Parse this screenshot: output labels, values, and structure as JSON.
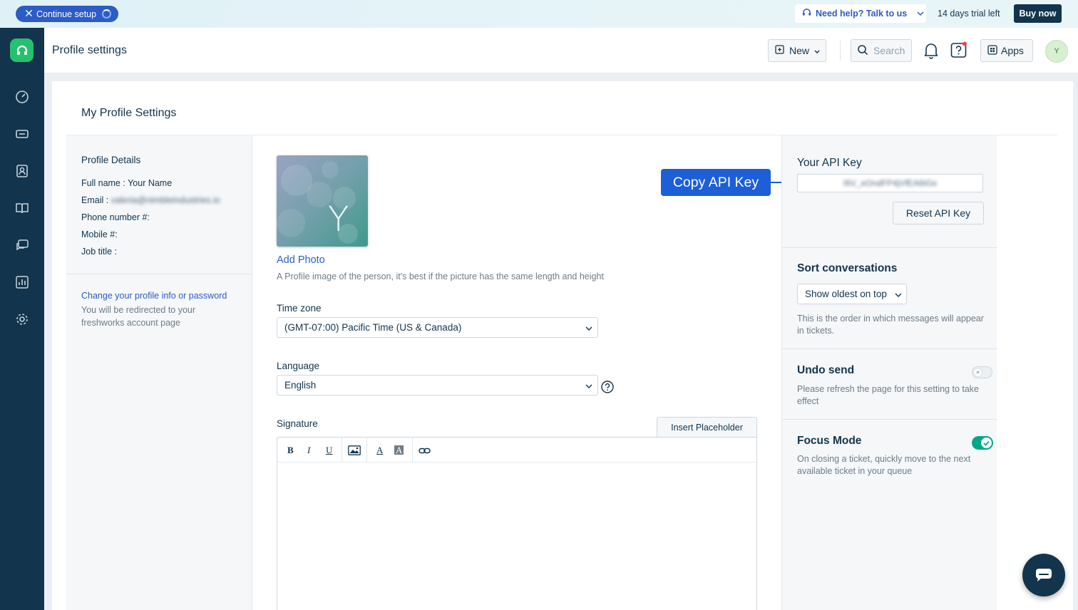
{
  "banner": {
    "continue_setup": "Continue setup",
    "need_help": "Need help? Talk to us",
    "trial": "14 days trial left",
    "buy_now": "Buy now"
  },
  "sidenav": {
    "items": [
      "dashboard",
      "tickets",
      "contacts",
      "solutions",
      "forums",
      "reports",
      "admin"
    ]
  },
  "header": {
    "title": "Profile settings",
    "new_label": "New",
    "search_placeholder": "Search",
    "apps_label": "Apps",
    "avatar_initial": "Y"
  },
  "card": {
    "title": "My Profile Settings"
  },
  "profile_details": {
    "title": "Profile Details",
    "full_name_label": "Full name :",
    "full_name_value": "Your Name",
    "email_label": "Email :",
    "email_value": "valeria@nimbleindustries.io",
    "phone_label": "Phone number #:",
    "mobile_label": "Mobile #:",
    "job_title_label": "Job title :",
    "change_link": "Change your profile info or password",
    "redirect_note": "You will be redirected to your freshworks account page"
  },
  "photo": {
    "initial": "Y",
    "add_photo": "Add Photo",
    "hint": "A Profile image of the person, it's best if the picture has the same length and height"
  },
  "time_zone": {
    "label": "Time zone",
    "value": "(GMT-07:00) Pacific Time (US & Canada)"
  },
  "language": {
    "label": "Language",
    "value": "English"
  },
  "signature": {
    "label": "Signature",
    "insert_placeholder": "Insert Placeholder",
    "toolbar": {
      "bold": "B",
      "italic": "I",
      "underline": "U",
      "font_color": "A",
      "bg_color": "A"
    }
  },
  "callout": {
    "copy_api_key": "Copy API Key"
  },
  "api_key": {
    "title": "Your API Key",
    "value": "I6V_eOndFP4jVfEA6iGe",
    "reset": "Reset API Key"
  },
  "sort_conversations": {
    "title": "Sort conversations",
    "value": "Show oldest on top",
    "note": "This is the order in which messages will appear in tickets."
  },
  "undo_send": {
    "title": "Undo send",
    "note": "Please refresh the page for this setting to take effect",
    "enabled": false
  },
  "focus_mode": {
    "title": "Focus Mode",
    "note": "On closing a ticket, quickly move to the next available ticket in your queue",
    "enabled": true
  },
  "colors": {
    "nav_bg": "#12344d",
    "accent": "#2c5cc5",
    "callout": "#1c5fd7",
    "brand_green": "#25c16f",
    "toggle_on": "#00a886"
  }
}
